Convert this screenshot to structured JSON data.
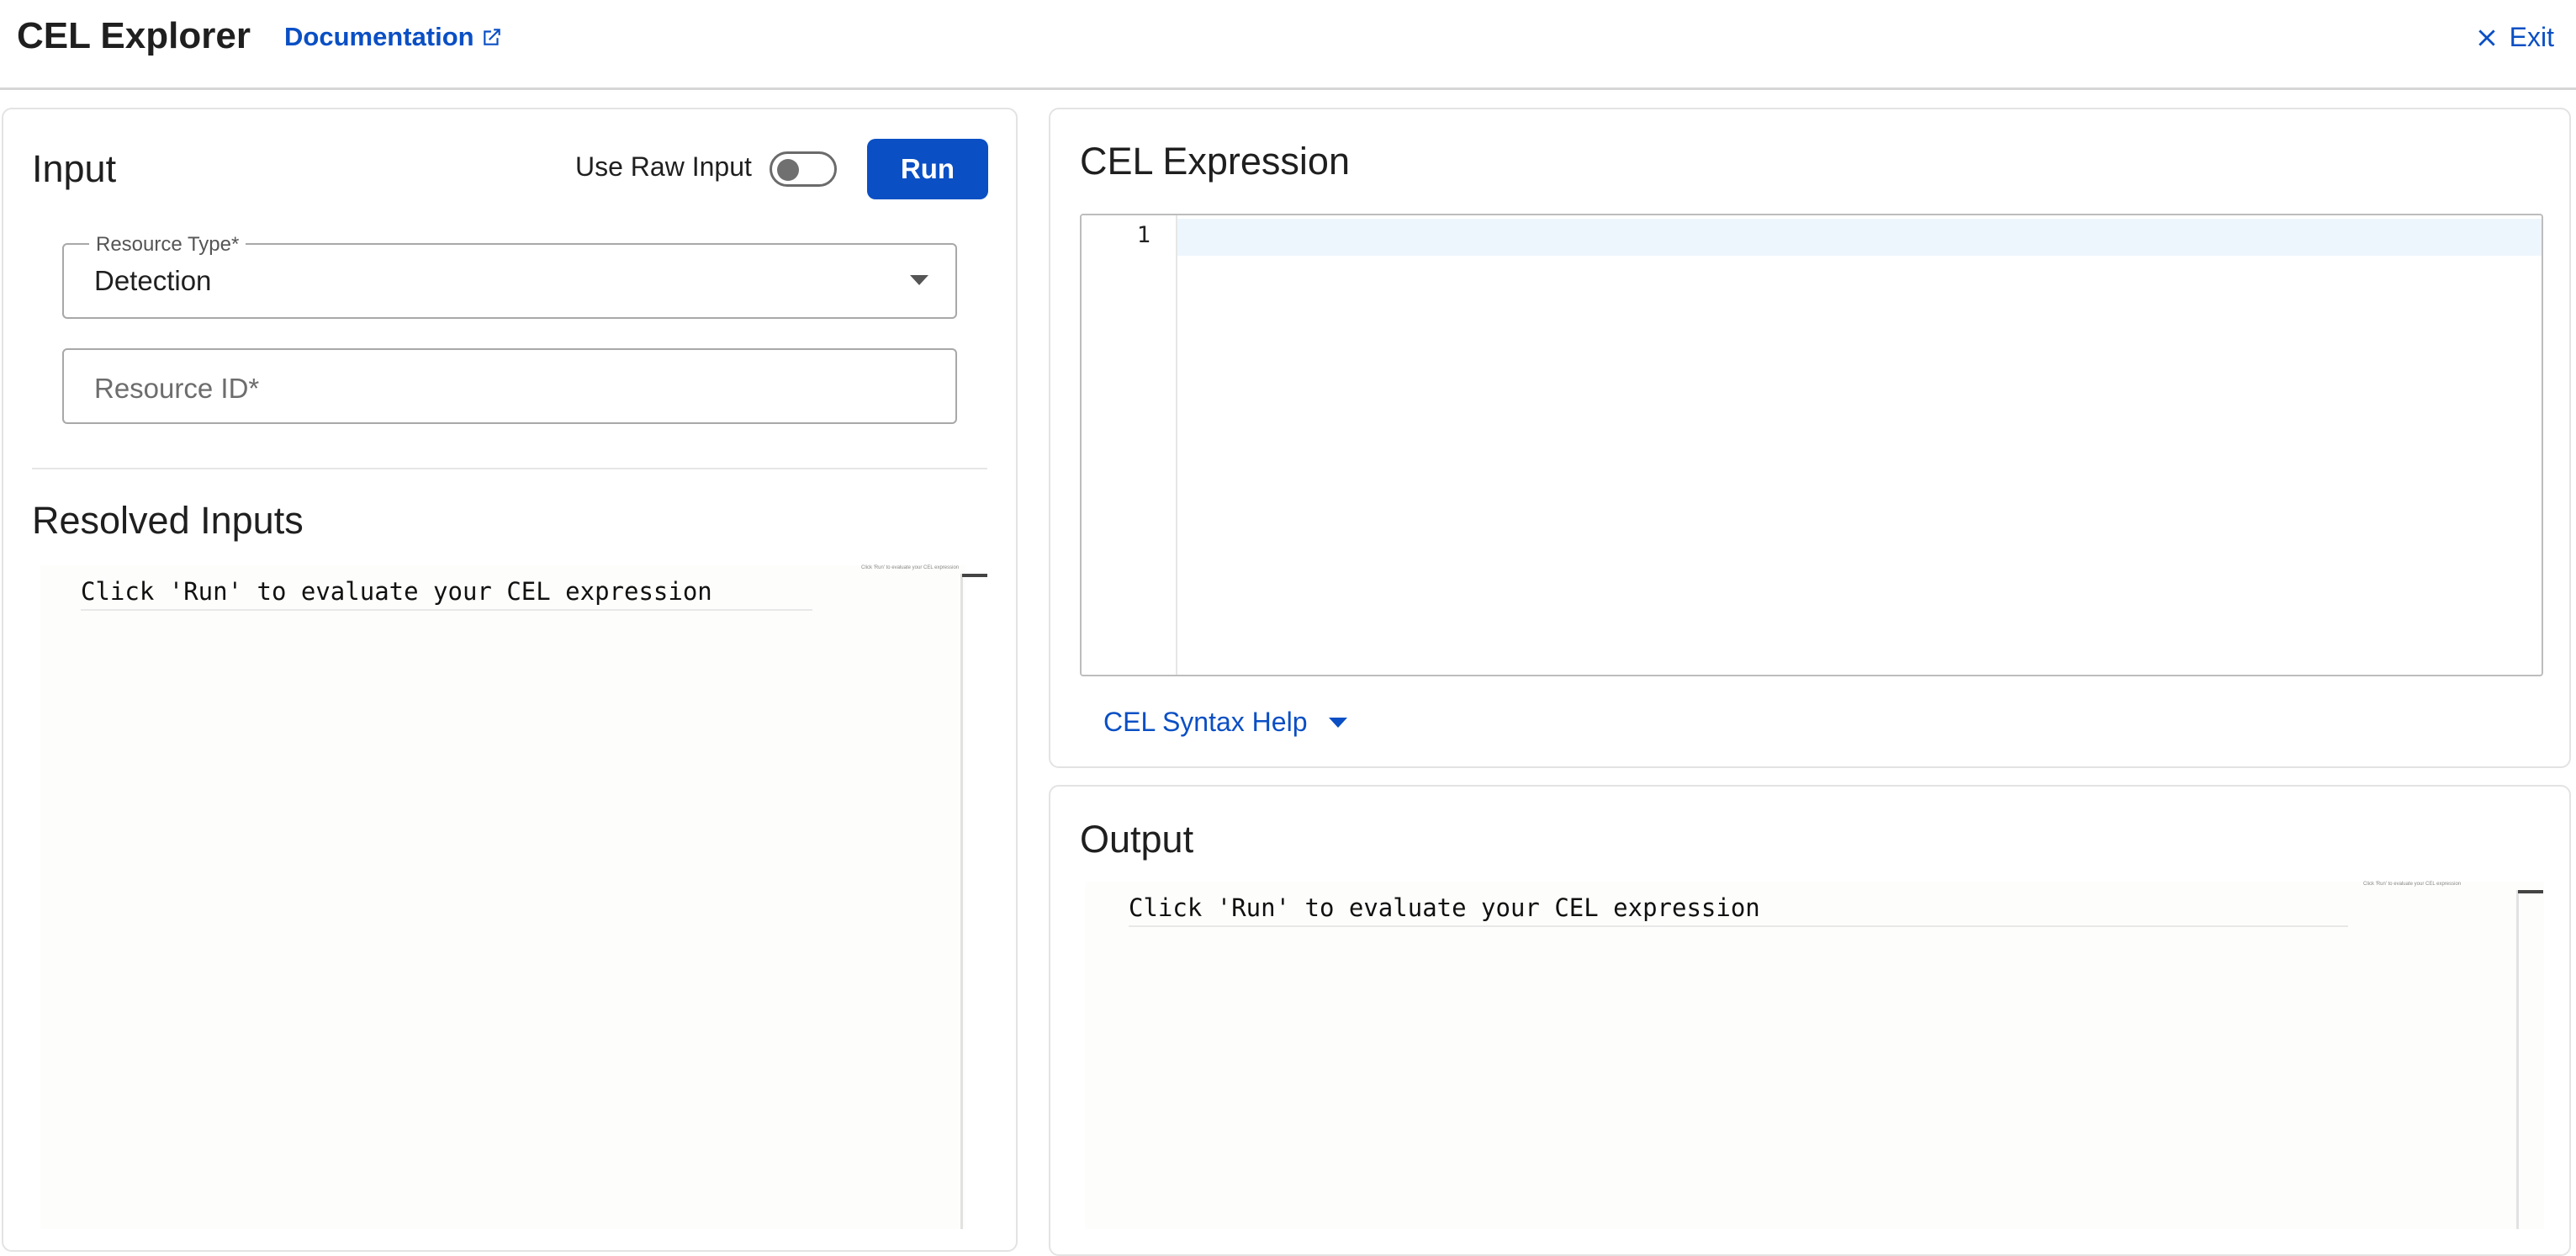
{
  "header": {
    "title": "CEL Explorer",
    "doc_link": "Documentation",
    "exit_label": "Exit"
  },
  "input_panel": {
    "title": "Input",
    "raw_input_label": "Use Raw Input",
    "raw_input_enabled": false,
    "run_label": "Run",
    "resource_type": {
      "legend": "Resource Type*",
      "value": "Detection"
    },
    "resource_id": {
      "placeholder": "Resource ID*",
      "value": ""
    },
    "resolved_title": "Resolved Inputs",
    "resolved_text": "Click 'Run' to evaluate your CEL expression"
  },
  "expression_panel": {
    "title": "CEL Expression",
    "line_numbers": [
      "1"
    ],
    "syntax_help": "CEL Syntax Help"
  },
  "output_panel": {
    "title": "Output",
    "text": "Click 'Run' to evaluate your CEL expression"
  },
  "colors": {
    "accent": "#0a4fc4",
    "border": "#e3e3e3",
    "text": "#1f1f1f"
  },
  "icons": {
    "external": "external-link-icon",
    "close": "close-icon",
    "dropdown": "chevron-down-icon"
  }
}
